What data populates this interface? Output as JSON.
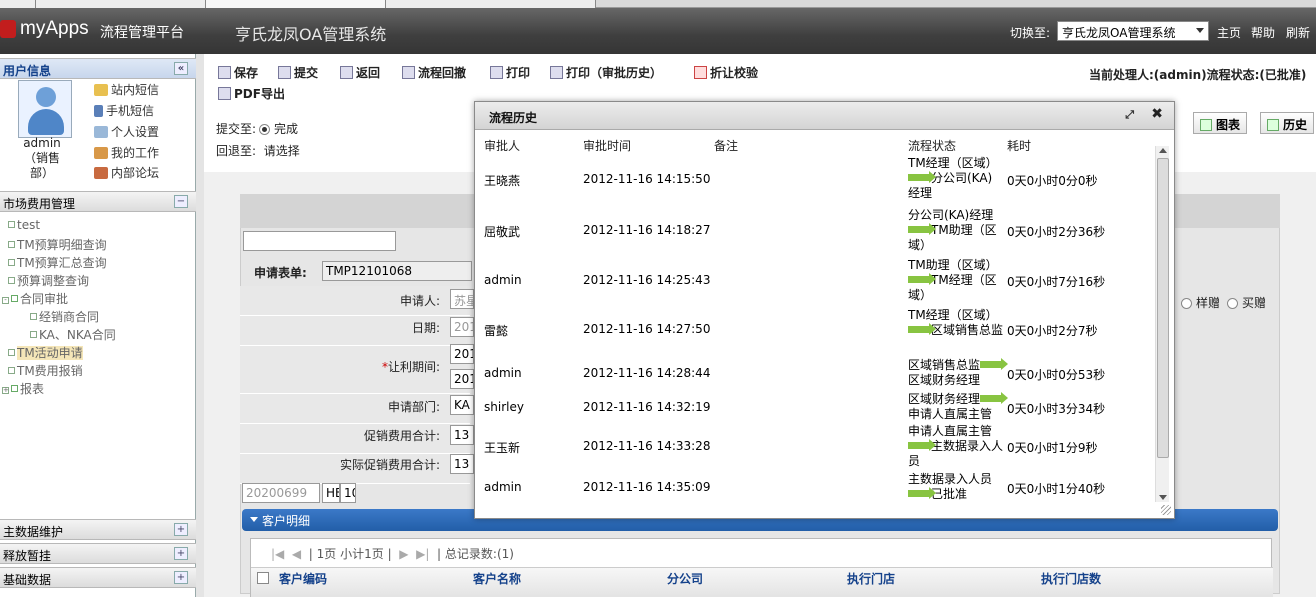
{
  "app": {
    "logo": "myApps",
    "platform": "流程管理平台",
    "system_title": "亨氏龙凤OA管理系统",
    "switch_label": "切换至:",
    "switch_value": "亨氏龙凤OA管理系统",
    "links": [
      "主页",
      "帮助",
      "刷新"
    ]
  },
  "sidebar": {
    "user_panel_title": "用户信息",
    "user_name": "admin（销售部）",
    "quick_links": [
      "站内短信",
      "手机短信",
      "个人设置",
      "我的工作",
      "内部论坛"
    ],
    "panel_title": "市场费用管理",
    "tree": [
      "test",
      "TM预算明细查询",
      "TM预算汇总查询",
      "预算调整查询",
      "合同审批",
      "经销商合同",
      "KA、NKA合同",
      "TM活动申请",
      "TM费用报销",
      "报表"
    ],
    "bottom_panels": [
      "主数据维护",
      "释放暂挂",
      "基础数据"
    ]
  },
  "toolbar": {
    "buttons": [
      "保存",
      "提交",
      "返回",
      "流程回撤",
      "打印",
      "打印（审批历史）",
      "折让校验",
      "PDF导出"
    ],
    "status": "当前处理人:(admin)流程状态:(已批准)",
    "submit_to_label": "提交至:",
    "submit_to_value": "完成",
    "return_to_label": "回退至:",
    "return_to_value": "请选择",
    "chart_button": "图表",
    "history_button": "历史"
  },
  "form": {
    "form_no_label": "申请表单:",
    "form_no": "TMP12101068",
    "labels": [
      "申请人:",
      "日期:",
      "让利期间:",
      "申请部门:",
      "促销费用合计:",
      "实际促销费用合计:"
    ],
    "values": [
      "苏星",
      "201",
      "201",
      "201",
      "KA",
      "13",
      "13"
    ],
    "bottom_inputs": [
      "20200699",
      "HE",
      "10"
    ],
    "radio_options": [
      "样赠",
      "买赠"
    ],
    "section_title": "客户明细",
    "pager_text": "1页 小计1页",
    "record_count": "总记录数:(1)",
    "columns": [
      "客户编码",
      "客户名称",
      "分公司",
      "执行门店",
      "执行门店数"
    ]
  },
  "modal": {
    "title": "流程历史",
    "headers": [
      "审批人",
      "审批时间",
      "备注",
      "流程状态",
      "耗时"
    ],
    "rows": [
      {
        "approver": "王晓燕",
        "time": "2012-11-16 14:15:50",
        "from": "TM经理（区域）",
        "to": "分公司(KA)经理",
        "duration": "0天0小时0分0秒"
      },
      {
        "approver": "屈敬武",
        "time": "2012-11-16 14:18:27",
        "from": "分公司(KA)经理",
        "to": "TM助理（区域）",
        "duration": "0天0小时2分36秒"
      },
      {
        "approver": "admin",
        "time": "2012-11-16 14:25:43",
        "from": "TM助理（区域）",
        "to": "TM经理（区域）",
        "duration": "0天0小时7分16秒"
      },
      {
        "approver": "雷懿",
        "time": "2012-11-16 14:27:50",
        "from": "TM经理（区域）",
        "to": "区域销售总监",
        "duration": "0天0小时2分7秒"
      },
      {
        "approver": "admin",
        "time": "2012-11-16 14:28:44",
        "from": "区域销售总监",
        "to": "区域财务经理",
        "duration": "0天0小时0分53秒"
      },
      {
        "approver": "shirley",
        "time": "2012-11-16 14:32:19",
        "from": "区域财务经理",
        "to": "申请人直属主管",
        "duration": "0天0小时3分34秒"
      },
      {
        "approver": "王玉新",
        "time": "2012-11-16 14:33:28",
        "from": "申请人直属主管",
        "to": "主数据录入人员",
        "duration": "0天0小时1分9秒"
      },
      {
        "approver": "admin",
        "time": "2012-11-16 14:35:09",
        "from": "主数据录入人员",
        "to": "已批准",
        "duration": "0天0小时1分40秒"
      }
    ]
  }
}
